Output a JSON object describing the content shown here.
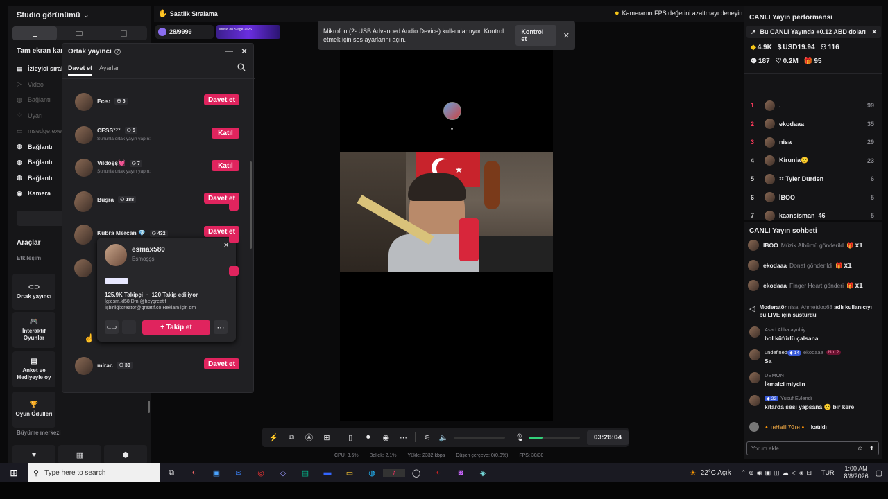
{
  "studio": {
    "view_title": "Studio görünümü",
    "fullscreen_label": "Tam ekran kam",
    "sources": [
      "İzleyici sıral",
      "Video",
      "Bağlantı",
      "Uyarı",
      "msedge.exe",
      "Bağlantı",
      "Bağlantı",
      "Bağlantı",
      "Kamera"
    ],
    "tools_title": "Araçlar",
    "engagement_label": "Etkileşim",
    "tools": [
      "Ortak yayıncı",
      "İnteraktif Oyunlar",
      "Anket ve Hediyeyle oy",
      "Oyun Ödülleri"
    ],
    "growth_label": "Büyüme merkezi"
  },
  "topbar": {
    "hourly_label": "Saatlik Sıralama",
    "hourly_count": "28/9999",
    "banner_text": "Music on Stage 2026",
    "fps_tip": "Kameranın FPS değerini azaltmayı deneyin"
  },
  "notice": {
    "text": "Mikrofon (2- USB Advanced Audio Device) kullanılamıyor. Kontrol etmek için ses ayarlarını açın.",
    "action": "Kontrol et"
  },
  "cohost": {
    "title": "Ortak yayıncı",
    "tabs": [
      "Davet et",
      "Ayarlar"
    ],
    "items": [
      {
        "name": "Ece♪",
        "count": "5",
        "sub": "",
        "action": "Davet et"
      },
      {
        "name": "CESS⁷⁷⁷",
        "count": "5",
        "sub": "Şununla ortak yayın yapın:",
        "action": "Katıl"
      },
      {
        "name": "Vildoşş💓",
        "count": "7",
        "sub": "Şununla ortak yayın yapın:",
        "action": "Katıl"
      },
      {
        "name": "Büşra",
        "count": "188",
        "sub": "",
        "action": "Davet et"
      },
      {
        "name": "Kübra Mercan 💎",
        "count": "432",
        "sub": "",
        "action": "Davet et"
      },
      {
        "name": "mirac",
        "count": "30",
        "sub": "",
        "action": "Davet et"
      }
    ]
  },
  "profile": {
    "username": "esmax580",
    "display": "Esmoşşşl",
    "followers": "125.9K Takipçi",
    "following": "120 Takip ediliyor",
    "bio1": "İg:esm.kl58 Dm:@heygreatif",
    "bio2": "İşbirliği:creator@greatif.co Reklam için dm",
    "follow_label": "+ Takip et"
  },
  "controls": {
    "timer": "03:26:04"
  },
  "stats": {
    "cpu": "CPU: 3.5%",
    "memory": "Bellek: 2.1%",
    "upload": "Yükle: 2332 kbps",
    "dropped": "Düşen çerçeve: 0(0.0%)",
    "fps": "FPS: 30/30"
  },
  "performance": {
    "title": "CANLI Yayın performansı",
    "promo": "Bu CANLI Yayında +0.12 ABD doları",
    "coins": "4.9K",
    "usd": "USD19.94",
    "viewers": "116",
    "new_followers": "187",
    "likes": "0.2M",
    "gifts": "95"
  },
  "ranking": [
    {
      "rank": "1",
      "name": ".",
      "score": "99"
    },
    {
      "rank": "2",
      "name": "ekodaaa",
      "score": "35"
    },
    {
      "rank": "3",
      "name": "nisa",
      "score": "29"
    },
    {
      "rank": "4",
      "name": "Kirunia😉",
      "score": "23"
    },
    {
      "rank": "5",
      "name": "ᵡᵡ Tyler Durden",
      "score": "6"
    },
    {
      "rank": "6",
      "name": "İBOO",
      "score": "5"
    },
    {
      "rank": "7",
      "name": "kaansisman_46",
      "score": "5"
    }
  ],
  "chat": {
    "title": "CANLI Yayın sohbeti",
    "gifts": [
      {
        "user": "IBOO",
        "action": "Müzik Albümü gönderild",
        "qty": "x1"
      },
      {
        "user": "ekodaaa",
        "action": "Donat gönderildi",
        "qty": "x1"
      },
      {
        "user": "ekodaaa",
        "action": "Finger Heart gönderi",
        "qty": "x1"
      }
    ],
    "mod_prefix": "Moderatör",
    "mod_user": "nisa,",
    "mod_target": "Ahmetdoo68",
    "mod_text_1": "adlı",
    "mod_text_2": "kullanıcıyı bu LIVE için susturdu",
    "messages": [
      {
        "user": "Asad Allha ayubiy",
        "level": "",
        "badge": "",
        "text": "bol küfürlü çalsana"
      },
      {
        "user": "ekodaaa",
        "level": "14",
        "badge": "No. 2",
        "text": "Sa"
      },
      {
        "user": "DEMON",
        "level": "",
        "badge": "",
        "text": "İkmalci miydin"
      },
      {
        "user": "Yusuf Evlendi",
        "level": "22",
        "badge": "",
        "text": "kitarda sesi yapsana 😉 bir kere"
      }
    ],
    "joined_user": "🔸ᴛʜHalil 70ᴛʜ🔸",
    "joined_text": "katıldı",
    "placeholder": "Yorum ekle"
  },
  "taskbar": {
    "search_placeholder": "Type here to search",
    "weather": "22°C  Açık",
    "lang": "TUR",
    "time": "1:00 AM",
    "date": "8/8/2026"
  }
}
